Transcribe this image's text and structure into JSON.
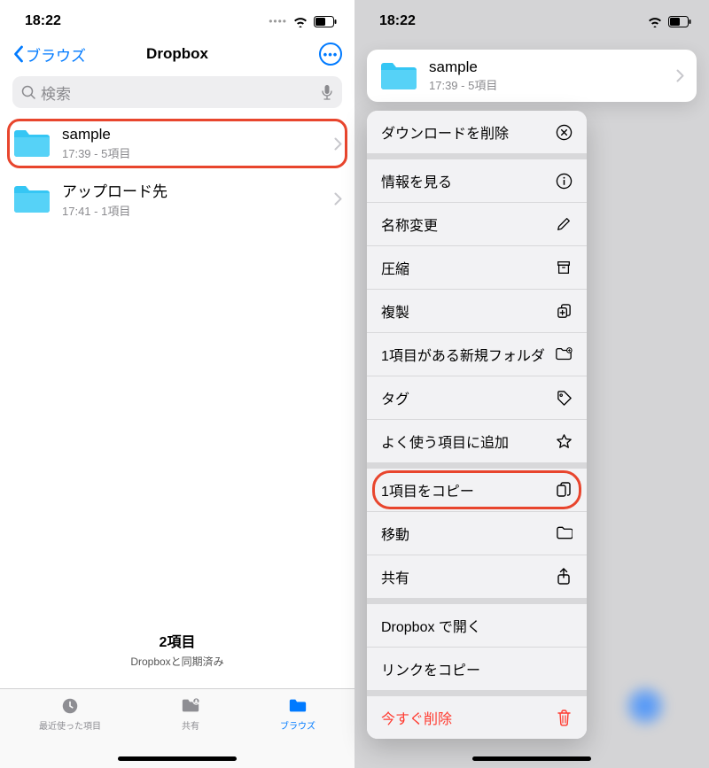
{
  "time": "18:22",
  "left": {
    "back_label": "ブラウズ",
    "title": "Dropbox",
    "search_placeholder": "検索",
    "rows": [
      {
        "title": "sample",
        "sub": "17:39 - 5項目"
      },
      {
        "title": "アップロード先",
        "sub": "17:41 - 1項目"
      }
    ],
    "footer_count": "2項目",
    "footer_sync": "Dropboxと同期済み",
    "tabs": {
      "recent": "最近使った項目",
      "shared": "共有",
      "browse": "ブラウズ"
    }
  },
  "right": {
    "preview": {
      "title": "sample",
      "sub": "17:39 - 5項目"
    },
    "menu": {
      "remove_download": "ダウンロードを削除",
      "info": "情報を見る",
      "rename": "名称変更",
      "compress": "圧縮",
      "duplicate": "複製",
      "new_folder": "1項目がある新規フォルダ",
      "tags": "タグ",
      "favorite": "よく使う項目に追加",
      "copy": "1項目をコピー",
      "move": "移動",
      "share": "共有",
      "open_dropbox": "Dropbox で開く",
      "copy_link": "リンクをコピー",
      "delete_now": "今すぐ削除"
    }
  }
}
